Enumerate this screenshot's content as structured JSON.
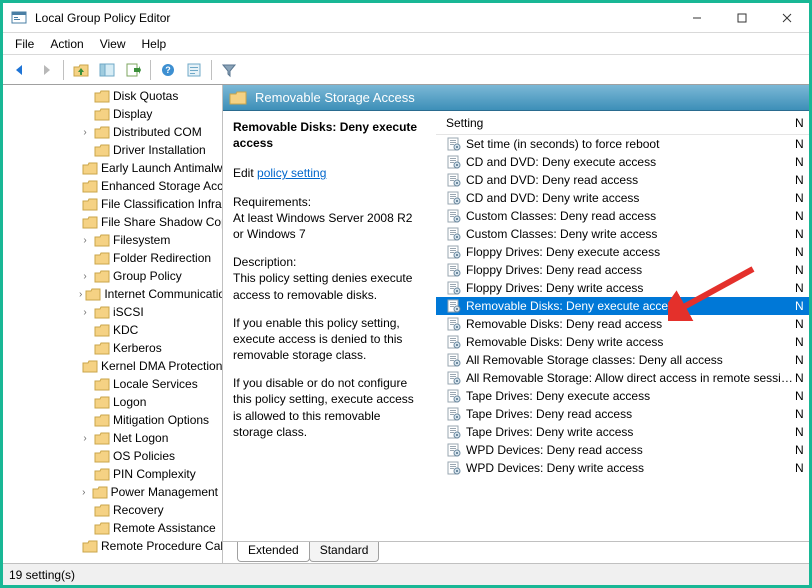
{
  "window": {
    "title": "Local Group Policy Editor"
  },
  "menus": [
    "File",
    "Action",
    "View",
    "Help"
  ],
  "tree": {
    "indent": 76,
    "items": [
      {
        "label": "Disk Quotas",
        "expandable": false
      },
      {
        "label": "Display",
        "expandable": false
      },
      {
        "label": "Distributed COM",
        "expandable": true
      },
      {
        "label": "Driver Installation",
        "expandable": false
      },
      {
        "label": "Early Launch Antimalware",
        "expandable": false
      },
      {
        "label": "Enhanced Storage Access",
        "expandable": false
      },
      {
        "label": "File Classification Infrastructure",
        "expandable": false
      },
      {
        "label": "File Share Shadow Copy",
        "expandable": false
      },
      {
        "label": "Filesystem",
        "expandable": true
      },
      {
        "label": "Folder Redirection",
        "expandable": false
      },
      {
        "label": "Group Policy",
        "expandable": true
      },
      {
        "label": "Internet Communication",
        "expandable": true
      },
      {
        "label": "iSCSI",
        "expandable": true
      },
      {
        "label": "KDC",
        "expandable": false
      },
      {
        "label": "Kerberos",
        "expandable": false
      },
      {
        "label": "Kernel DMA Protection",
        "expandable": false
      },
      {
        "label": "Locale Services",
        "expandable": false
      },
      {
        "label": "Logon",
        "expandable": false
      },
      {
        "label": "Mitigation Options",
        "expandable": false
      },
      {
        "label": "Net Logon",
        "expandable": true
      },
      {
        "label": "OS Policies",
        "expandable": false
      },
      {
        "label": "PIN Complexity",
        "expandable": false
      },
      {
        "label": "Power Management",
        "expandable": true
      },
      {
        "label": "Recovery",
        "expandable": false
      },
      {
        "label": "Remote Assistance",
        "expandable": false
      },
      {
        "label": "Remote Procedure Call",
        "expandable": false
      }
    ]
  },
  "header_band": {
    "title": "Removable Storage Access"
  },
  "description": {
    "selected_title": "Removable Disks: Deny execute access",
    "edit_prefix": "Edit ",
    "edit_link": "policy setting",
    "requirements_label": "Requirements:",
    "requirements_text": "At least Windows Server 2008 R2 or Windows 7",
    "description_label": "Description:",
    "description_text": "This policy setting denies execute access to removable disks.",
    "enable_text": "If you enable this policy setting, execute access is denied to this removable storage class.",
    "disable_text": "If you disable or do not configure this policy setting, execute access is allowed to this removable storage class."
  },
  "list": {
    "header_setting": "Setting",
    "header_state_abbrev": "N",
    "rows": [
      {
        "label": "Set time (in seconds) to force reboot",
        "state": "N",
        "selected": false
      },
      {
        "label": "CD and DVD: Deny execute access",
        "state": "N",
        "selected": false
      },
      {
        "label": "CD and DVD: Deny read access",
        "state": "N",
        "selected": false
      },
      {
        "label": "CD and DVD: Deny write access",
        "state": "N",
        "selected": false
      },
      {
        "label": "Custom Classes: Deny read access",
        "state": "N",
        "selected": false
      },
      {
        "label": "Custom Classes: Deny write access",
        "state": "N",
        "selected": false
      },
      {
        "label": "Floppy Drives: Deny execute access",
        "state": "N",
        "selected": false
      },
      {
        "label": "Floppy Drives: Deny read access",
        "state": "N",
        "selected": false
      },
      {
        "label": "Floppy Drives: Deny write access",
        "state": "N",
        "selected": false
      },
      {
        "label": "Removable Disks: Deny execute access",
        "state": "N",
        "selected": true
      },
      {
        "label": "Removable Disks: Deny read access",
        "state": "N",
        "selected": false
      },
      {
        "label": "Removable Disks: Deny write access",
        "state": "N",
        "selected": false
      },
      {
        "label": "All Removable Storage classes: Deny all access",
        "state": "N",
        "selected": false
      },
      {
        "label": "All Removable Storage: Allow direct access in remote sessions",
        "state": "N",
        "selected": false
      },
      {
        "label": "Tape Drives: Deny execute access",
        "state": "N",
        "selected": false
      },
      {
        "label": "Tape Drives: Deny read access",
        "state": "N",
        "selected": false
      },
      {
        "label": "Tape Drives: Deny write access",
        "state": "N",
        "selected": false
      },
      {
        "label": "WPD Devices: Deny read access",
        "state": "N",
        "selected": false
      },
      {
        "label": "WPD Devices: Deny write access",
        "state": "N",
        "selected": false
      }
    ]
  },
  "tabs": {
    "extended": "Extended",
    "standard": "Standard",
    "active": "extended"
  },
  "statusbar": {
    "text": "19 setting(s)"
  },
  "colors": {
    "selection": "#0078d7",
    "accent": "#18b795"
  }
}
